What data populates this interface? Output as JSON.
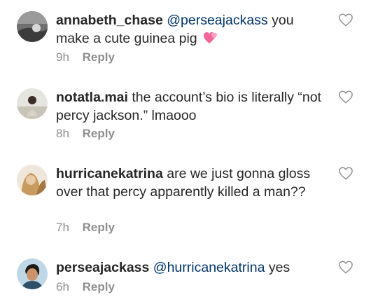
{
  "comments": [
    {
      "username": "annabeth_chase",
      "mention": "@perseajackass",
      "text": " you make a cute guinea pig",
      "emoji": "two-hearts-emoji",
      "time": "9h",
      "reply": "Reply"
    },
    {
      "username": "notatla.mai",
      "mention": "",
      "text": " the account’s bio is literally “not percy jackson.” lmaooo",
      "time": "8h",
      "reply": "Reply"
    },
    {
      "username": "hurricanekatrina",
      "mention": "",
      "text": " are we just gonna gloss over that percy apparently killed a man??",
      "time": "7h",
      "reply": "Reply"
    },
    {
      "username": "perseajackass",
      "mention": "@hurricanekatrina",
      "text": " yes",
      "time": "6h",
      "reply": "Reply"
    }
  ],
  "icons": {
    "like": "heart-outline-icon"
  },
  "colors": {
    "mention": "#003569",
    "meta": "#8e8e8e",
    "text": "#262626"
  }
}
